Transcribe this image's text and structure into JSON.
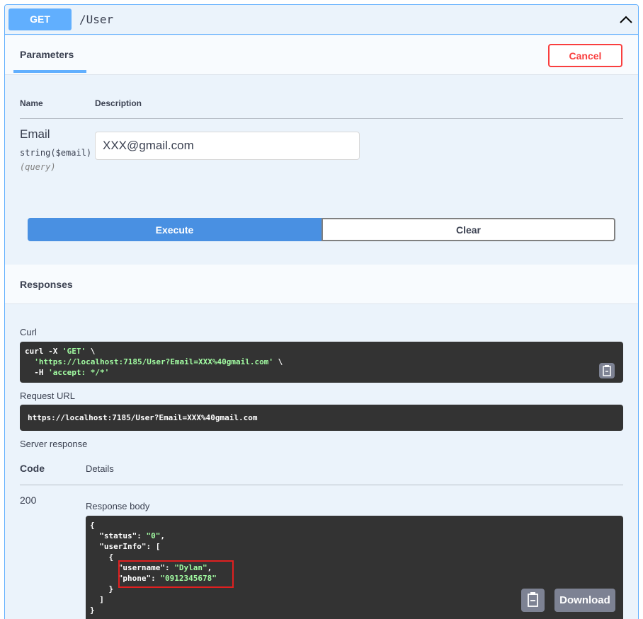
{
  "operation": {
    "method": "GET",
    "path": "/User"
  },
  "parameters_tab": {
    "title": "Parameters",
    "cancel_label": "Cancel"
  },
  "parameters_table": {
    "headers": {
      "name": "Name",
      "description": "Description"
    },
    "rows": [
      {
        "name": "Email",
        "type": "string($email)",
        "in": "(query)",
        "value": "XXX@gmail.com"
      }
    ]
  },
  "actions": {
    "execute_label": "Execute",
    "clear_label": "Clear"
  },
  "responses": {
    "title": "Responses",
    "curl_label": "Curl",
    "curl_lines": {
      "line1_prefix": "curl -X ",
      "line1_str": "'GET'",
      "line1_suffix": " \\",
      "line2_str": "'https://localhost:7185/User?Email=XXX%40gmail.com'",
      "line2_suffix": " \\",
      "line3_prefix": "-H ",
      "line3_str": "'accept: */*'"
    },
    "request_url_label": "Request URL",
    "request_url": "https://localhost:7185/User?Email=XXX%40gmail.com",
    "server_response_label": "Server response",
    "table_headers": {
      "code": "Code",
      "details": "Details"
    },
    "status_code": "200",
    "response_body_label": "Response body",
    "body": {
      "status_key": "\"status\"",
      "status_val": "\"0\"",
      "userinfo_key": "\"userInfo\"",
      "username_key": "\"username\"",
      "username_val": "\"Dylan\"",
      "phone_key": "\"phone\"",
      "phone_val": "\"0912345678\""
    },
    "download_label": "Download"
  },
  "icons": {
    "collapse": "chevron-up-icon",
    "copy": "clipboard-copy-icon"
  },
  "colors": {
    "get_accent": "#61affe",
    "execute": "#4990e2",
    "cancel": "#f93e3e",
    "code_bg": "#333333",
    "code_string": "#a2fca2",
    "highlight": "#e02020"
  }
}
